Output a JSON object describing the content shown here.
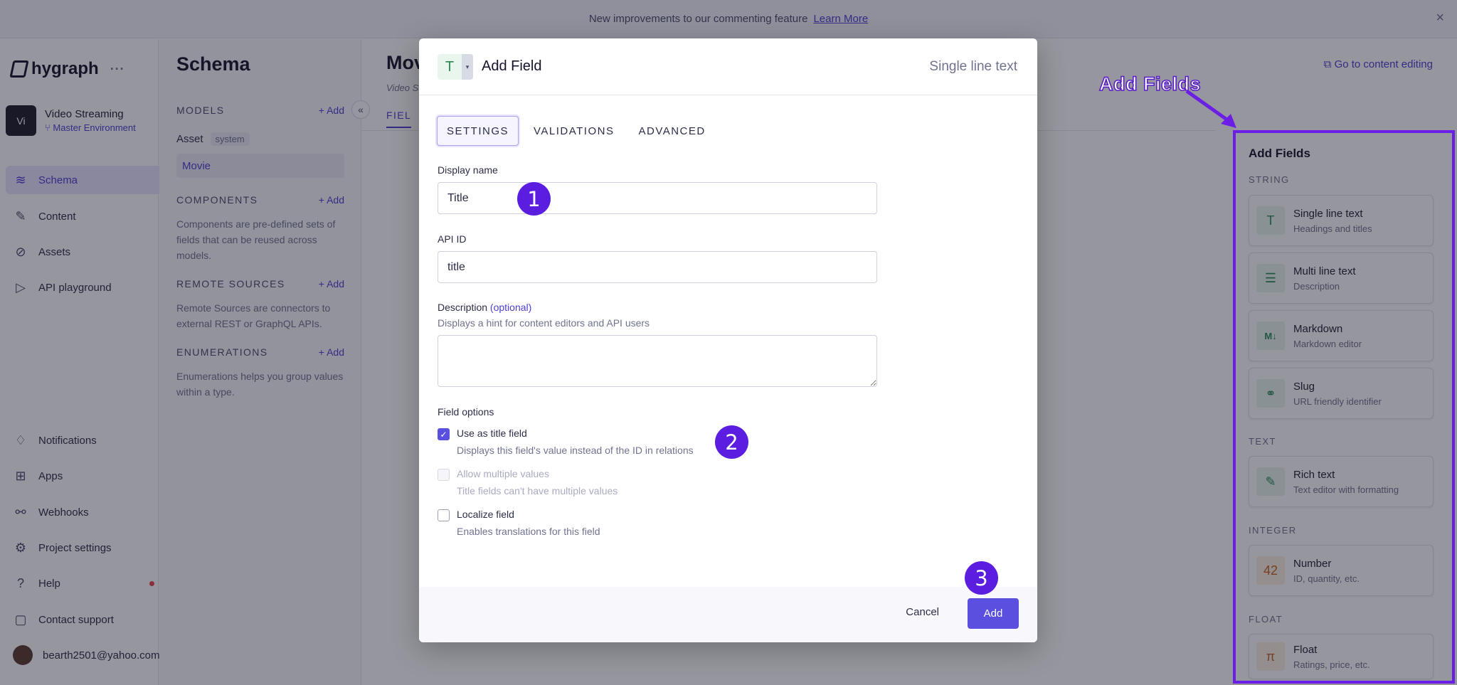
{
  "banner": {
    "text": "New improvements to our commenting feature",
    "link": "Learn More",
    "close": "×"
  },
  "sidebar": {
    "logo": "hygraph",
    "logo_more": "···",
    "project": {
      "avatar": "Vi",
      "name": "Video Streaming",
      "env": "Master Environment"
    },
    "top_items": [
      {
        "label": "Schema",
        "icon": "layers-icon",
        "glyph": "≋"
      },
      {
        "label": "Content",
        "icon": "edit-icon",
        "glyph": "✎"
      },
      {
        "label": "Assets",
        "icon": "paperclip-icon",
        "glyph": "⊘"
      },
      {
        "label": "API playground",
        "icon": "play-icon",
        "glyph": "▷"
      }
    ],
    "bottom_items": [
      {
        "label": "Notifications",
        "icon": "bell-icon",
        "glyph": "♢"
      },
      {
        "label": "Apps",
        "icon": "apps-icon",
        "glyph": "⊞"
      },
      {
        "label": "Webhooks",
        "icon": "webhook-icon",
        "glyph": "⚯"
      },
      {
        "label": "Project settings",
        "icon": "gear-icon",
        "glyph": "⚙"
      },
      {
        "label": "Help",
        "icon": "help-icon",
        "glyph": "?"
      },
      {
        "label": "Contact support",
        "icon": "chat-icon",
        "glyph": "▢"
      }
    ],
    "user_email": "bearth2501@yahoo.com"
  },
  "schema": {
    "title": "Schema",
    "models_head": "MODELS",
    "add": "+ Add",
    "models": [
      {
        "name": "Asset",
        "tag": "system"
      },
      {
        "name": "Movie"
      }
    ],
    "components_head": "COMPONENTS",
    "components_text": "Components are pre-defined sets of fields that can be reused across models.",
    "remote_head": "REMOTE SOURCES",
    "remote_text": "Remote Sources are connectors to external REST or GraphQL APIs.",
    "enum_head": "ENUMERATIONS",
    "enum_text": "Enumerations helps you group values within a type.",
    "collapse": "«"
  },
  "main": {
    "title": "Mov",
    "subtitle": "Video S",
    "tab": "FIEL",
    "goto": "Go to content editing"
  },
  "right_panel": {
    "title": "Add Fields",
    "sections": {
      "string": "STRING",
      "text": "TEXT",
      "integer": "INTEGER",
      "float": "FLOAT"
    },
    "cards": [
      {
        "title": "Single line text",
        "sub": "Headings and titles",
        "glyph": "T",
        "icon": "text-icon"
      },
      {
        "title": "Multi line text",
        "sub": "Description",
        "glyph": "☰",
        "icon": "multiline-icon"
      },
      {
        "title": "Markdown",
        "sub": "Markdown editor",
        "glyph": "M↓",
        "icon": "markdown-icon"
      },
      {
        "title": "Slug",
        "sub": "URL friendly identifier",
        "glyph": "⚭",
        "icon": "link-icon"
      },
      {
        "title": "Rich text",
        "sub": "Text editor with formatting",
        "glyph": "✎",
        "icon": "richtext-icon"
      },
      {
        "title": "Number",
        "sub": "ID, quantity, etc.",
        "glyph": "42",
        "icon": "number-icon"
      },
      {
        "title": "Float",
        "sub": "Ratings, price, etc.",
        "glyph": "π",
        "icon": "pi-icon"
      }
    ]
  },
  "annotation": {
    "label": "Add Fields",
    "steps": [
      "1",
      "2",
      "3"
    ],
    "color": "#5b1de0"
  },
  "modal": {
    "type_glyph": "T",
    "title": "Add Field",
    "type_name": "Single line text",
    "tabs": [
      "SETTINGS",
      "VALIDATIONS",
      "ADVANCED"
    ],
    "display_name": {
      "label": "Display name",
      "value": "Title"
    },
    "api_id": {
      "label": "API ID",
      "value": "title"
    },
    "description": {
      "label": "Description",
      "optional": "(optional)",
      "hint": "Displays a hint for content editors and API users"
    },
    "field_options": "Field options",
    "options": [
      {
        "label": "Use as title field",
        "sub": "Displays this field's value instead of the ID in relations",
        "checked": true,
        "disabled": false
      },
      {
        "label": "Allow multiple values",
        "sub": "Title fields can't have multiple values",
        "checked": false,
        "disabled": true
      },
      {
        "label": "Localize field",
        "sub": "Enables translations for this field",
        "checked": false,
        "disabled": false
      }
    ],
    "cancel": "Cancel",
    "add": "Add"
  },
  "colors": {
    "accent": "#5b4fe0",
    "annotation": "#6a1ee6"
  }
}
